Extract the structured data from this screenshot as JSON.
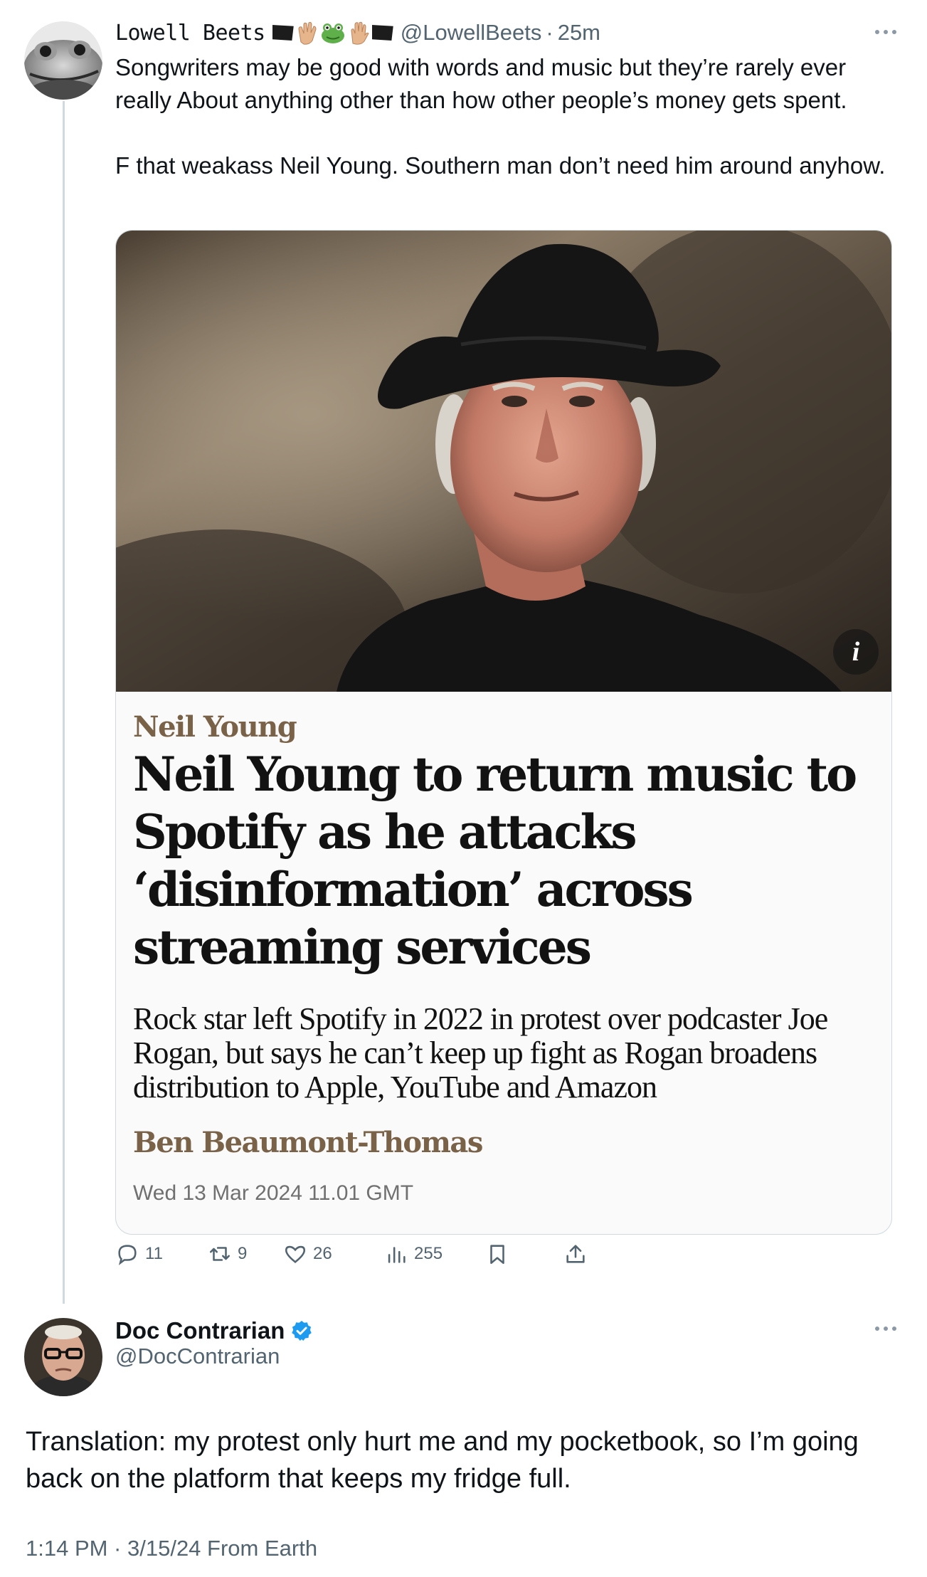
{
  "tweet1": {
    "display_name": "Lowell Beets",
    "emoji_icons": [
      "black-flag-icon",
      "clapping-hands-icon",
      "frog-icon",
      "raised-hand-icon",
      "black-flag-icon"
    ],
    "handle": "@LowellBeets",
    "separator": "·",
    "time": "25m",
    "text": "Songwriters may be good with words and music but they’re rarely ever really About anything other than how other people’s money gets spent.\n\nF that weakass Neil Young. Southern man don’t need him around anyhow.",
    "card": {
      "info_label": "i",
      "kicker": "Neil Young",
      "headline": "Neil Young to return music to Spotify as he attacks ‘disinformation’ across streaming services",
      "standfirst": "Rock star left Spotify in 2022 in protest over podcaster Joe Rogan, but says he can’t keep up fight as Rogan broadens distribution to Apple, YouTube and Amazon",
      "byline": "Ben Beaumont-Thomas",
      "date": "Wed 13 Mar 2024 11.01 GMT"
    },
    "actions": {
      "replies": "11",
      "reposts": "9",
      "likes": "26",
      "views": "255"
    }
  },
  "tweet2": {
    "display_name": "Doc Contrarian",
    "verified": true,
    "handle": "@DocContrarian",
    "text": "Translation: my protest only hurt me and my pocketbook, so I’m going back on the platform that keeps my fridge full.",
    "meta": "1:14 PM · 3/15/24 From Earth"
  },
  "colors": {
    "text": "#0f1419",
    "muted": "#536471",
    "verified": "#1d9bf0",
    "kicker": "#7a6249",
    "border": "#cfd9de"
  }
}
